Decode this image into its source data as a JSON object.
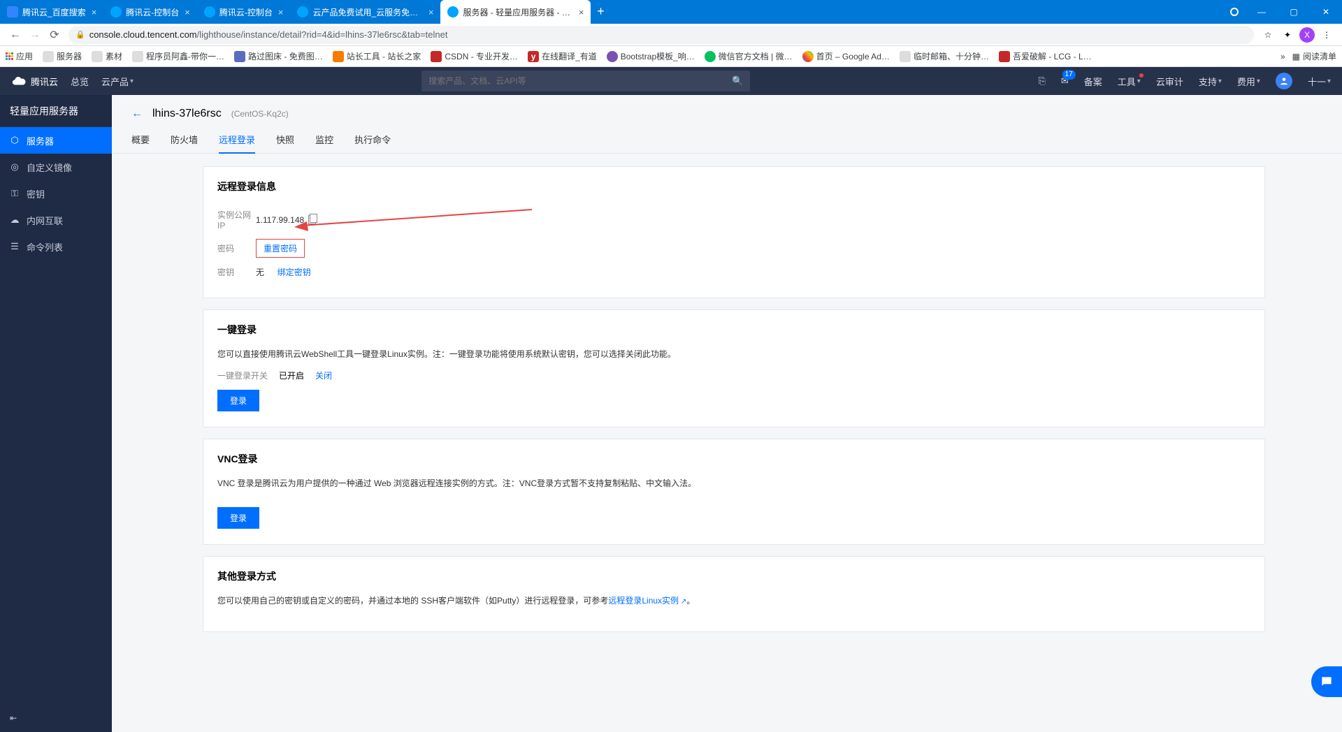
{
  "browser": {
    "tabs": [
      {
        "title": "腾讯云_百度搜索"
      },
      {
        "title": "腾讯云-控制台"
      },
      {
        "title": "腾讯云-控制台"
      },
      {
        "title": "云产品免费试用_云服务免费体验"
      },
      {
        "title": "服务器 - 轻量应用服务器 - 控制"
      }
    ],
    "url_host": "console.cloud.tencent.com",
    "url_path": "/lighthouse/instance/detail?rid=4&id=lhins-37le6rsc&tab=telnet",
    "avatar_letter": "X"
  },
  "bookmarks": {
    "apps": "应用",
    "items": [
      "服务器",
      "素材",
      "程序员阿鑫-带你一…",
      "路过图床 - 免费图…",
      "站长工具 - 站长之家",
      "CSDN - 专业开发…",
      "在线翻译_有道",
      "Bootstrap模板_响…",
      "微信官方文档 | 微…",
      "首页 – Google Ad…",
      "临时邮箱、十分钟…",
      "吾爱破解 - LCG - L…"
    ],
    "more": "»",
    "reading": "阅读清单"
  },
  "tc_top": {
    "brand": "腾讯云",
    "overview": "总览",
    "products": "云产品",
    "search_placeholder": "搜索产品、文档、云API等",
    "beian": "备案",
    "tools": "工具",
    "audit": "云审计",
    "support": "支持",
    "fee": "费用",
    "user": "十一",
    "msg_count": "17"
  },
  "sidebar": {
    "title": "轻量应用服务器",
    "items": [
      {
        "icon": "hexagon",
        "label": "服务器",
        "active": true
      },
      {
        "icon": "image",
        "label": "自定义镜像"
      },
      {
        "icon": "key",
        "label": "密钥"
      },
      {
        "icon": "cloud",
        "label": "内网互联"
      },
      {
        "icon": "list",
        "label": "命令列表"
      }
    ]
  },
  "page": {
    "instance_id": "lhins-37le6rsc",
    "alias": "(CentOS-Kq2c)",
    "tabs": [
      "概要",
      "防火墙",
      "远程登录",
      "快照",
      "监控",
      "执行命令"
    ],
    "active_tab": 2
  },
  "card_login_info": {
    "title": "远程登录信息",
    "ip_label": "实例公网IP",
    "ip": "1.117.99.148",
    "pwd_label": "密码",
    "pwd_action": "重置密码",
    "key_label": "密钥",
    "key_none": "无",
    "key_action": "绑定密钥"
  },
  "card_oneclick": {
    "title": "一键登录",
    "desc": "您可以直接使用腾讯云WebShell工具一键登录Linux实例。注：一键登录功能将使用系统默认密钥，您可以选择关闭此功能。",
    "switch_label": "一键登录开关",
    "switch_state": "已开启",
    "switch_action": "关闭",
    "btn": "登录"
  },
  "card_vnc": {
    "title": "VNC登录",
    "desc": "VNC 登录是腾讯云为用户提供的一种通过 Web 浏览器远程连接实例的方式。注：VNC登录方式暂不支持复制粘贴、中文输入法。",
    "btn": "登录"
  },
  "card_other": {
    "title": "其他登录方式",
    "desc_pre": "您可以使用自己的密钥或自定义的密码，并通过本地的 SSH客户端软件（如Putty）进行远程登录，可参考",
    "link": "远程登录Linux实例",
    "desc_post": "。"
  }
}
